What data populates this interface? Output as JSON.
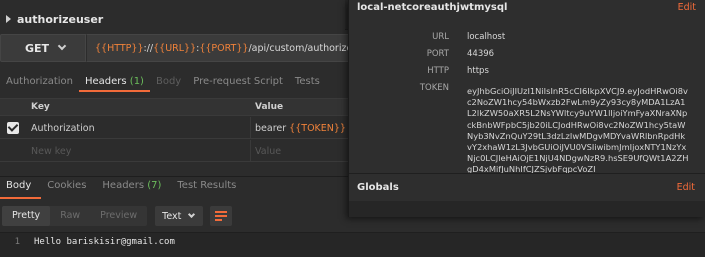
{
  "request_tab": {
    "title": "authorizeuser"
  },
  "request": {
    "method": "GET",
    "url_parts": [
      {
        "text": "{{HTTP}}",
        "var": true
      },
      {
        "text": "://",
        "var": false
      },
      {
        "text": "{{URL}}",
        "var": true
      },
      {
        "text": ":",
        "var": false
      },
      {
        "text": "{{PORT}}",
        "var": true
      },
      {
        "text": "/api/custom/authorizeuser",
        "var": false
      }
    ]
  },
  "request_tabs": {
    "authorization": "Authorization",
    "headers": "Headers",
    "headers_count": "(1)",
    "body": "Body",
    "prerequest": "Pre-request Script",
    "tests": "Tests"
  },
  "headers_table": {
    "key_header": "Key",
    "value_header": "Value",
    "row_key": "Authorization",
    "row_value_prefix": "bearer ",
    "row_value_var": "{{TOKEN}}",
    "new_key_placeholder": "New key",
    "new_value_placeholder": "Value"
  },
  "response_tabs": {
    "body": "Body",
    "cookies": "Cookies",
    "headers": "Headers",
    "headers_count": "(7)",
    "test_results": "Test Results"
  },
  "response_toolbar": {
    "pretty": "Pretty",
    "raw": "Raw",
    "preview": "Preview",
    "format": "Text"
  },
  "response_body": {
    "line_number": "1",
    "line_text": "Hello bariskisir@gmail.com"
  },
  "environment_popover": {
    "title": "local-netcoreauthjwtmysql",
    "edit_label": "Edit",
    "vars": {
      "url_label": "URL",
      "url_value": "localhost",
      "port_label": "PORT",
      "port_value": "44396",
      "http_label": "HTTP",
      "http_value": "https",
      "token_label": "TOKEN",
      "token_value": "eyJhbGciOiJIUzI1NiIsInR5cCI6IkpXVCJ9.eyJodHRwOi8vc2NoZW1hcy54bWxzb2FwLm9yZy93cy8yMDA1LzA1L2lkZW50aXR5L2NsYWltcy9uYW1lIjoiYmFyaXNraXNpckBnbWFpbC5jb20iLCJodHRwOi8vc2NoZW1hcy5taWNyb3NvZnQuY29tL3dzLzIwMDgvMDYvaWRlbnRpdHkvY2xhaW1zL3JvbGUiOiJVU0VSIiwibmJmIjoxNTY1NzYxNjc0LCJleHAiOjE1NjU4NDgwNzR9.hsSE9UfQWt1A2ZHgD4xMifJuNhIfCJZSjvbFqpcVoZI"
    },
    "globals_title": "Globals",
    "globals_edit_label": "Edit"
  }
}
